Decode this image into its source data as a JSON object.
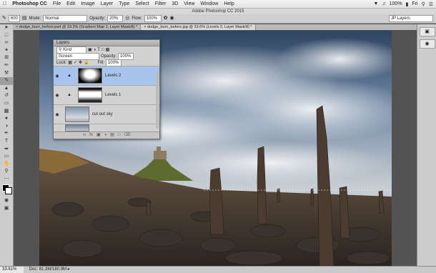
{
  "menubar": {
    "app": "Photoshop CC",
    "items": [
      "File",
      "Edit",
      "Image",
      "Layer",
      "Type",
      "Select",
      "Filter",
      "3D",
      "View",
      "Window",
      "Help"
    ],
    "battery": "100%",
    "day": "Fri"
  },
  "window_title": "Adobe Photoshop CC 2015",
  "options": {
    "brush_size": "600",
    "mode_label": "Mode:",
    "mode_value": "Normal",
    "opacity_label": "Opacity:",
    "opacity_value": "20%",
    "flow_label": "Flow:",
    "flow_value": "100%",
    "workspace": "JP Layers"
  },
  "tabs": [
    "dodge_burn_before.psd @ 33.3% (Gradient Map 1, Layer Mask/8) *",
    "dodge_burn_before.jpg @ 33.6% (Levels 2, Layer Mask/8) *"
  ],
  "layers_panel": {
    "title": "Layers",
    "kind_label": "Kind",
    "blend_mode": "Screen",
    "opacity_label": "Opacity:",
    "opacity_value": "100%",
    "lock_label": "Lock:",
    "fill_label": "Fill:",
    "fill_value": "100%",
    "layers": [
      {
        "name": "Levels 2"
      },
      {
        "name": "Levels 1"
      },
      {
        "name": "cut out sky"
      },
      {
        "name": ""
      }
    ]
  },
  "status": {
    "zoom": "33.61%",
    "doc": "Doc: 81.3M/180.9M"
  },
  "colors": {
    "selected_layer": "#a9c4ec",
    "panel_bg": "#d2d2d2"
  }
}
